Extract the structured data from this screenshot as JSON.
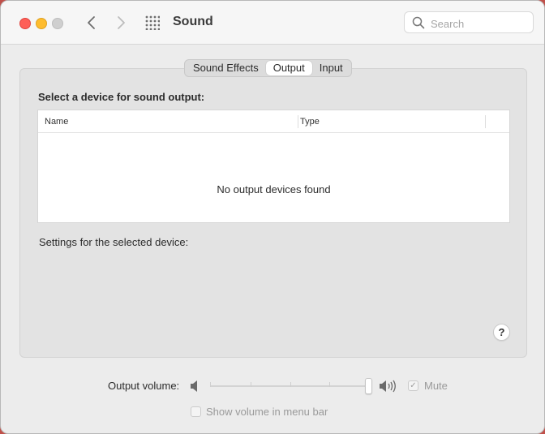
{
  "window": {
    "title": "Sound",
    "search_placeholder": "Search"
  },
  "tabs": [
    {
      "label": "Sound Effects",
      "active": false
    },
    {
      "label": "Output",
      "active": true
    },
    {
      "label": "Input",
      "active": false
    }
  ],
  "output": {
    "device_prompt": "Select a device for sound output:",
    "columns": [
      "Name",
      "Type"
    ],
    "empty_message": "No output devices found",
    "settings_label": "Settings for the selected device:",
    "help_label": "?"
  },
  "volume": {
    "label": "Output volume:",
    "level": 1.0,
    "mute_label": "Mute",
    "mute_checked": true,
    "show_in_menubar_label": "Show volume in menu bar",
    "show_in_menubar_checked": false
  },
  "colors": {
    "close": "#fe5f57",
    "minimize": "#febc2e",
    "zoom": "#cfcfcf"
  },
  "icons": {
    "back": "chevron-left-icon",
    "forward": "chevron-right-icon",
    "grid": "grid-icon",
    "search": "search-icon",
    "speaker_low": "speaker-low-icon",
    "speaker_high": "speaker-high-icon"
  }
}
